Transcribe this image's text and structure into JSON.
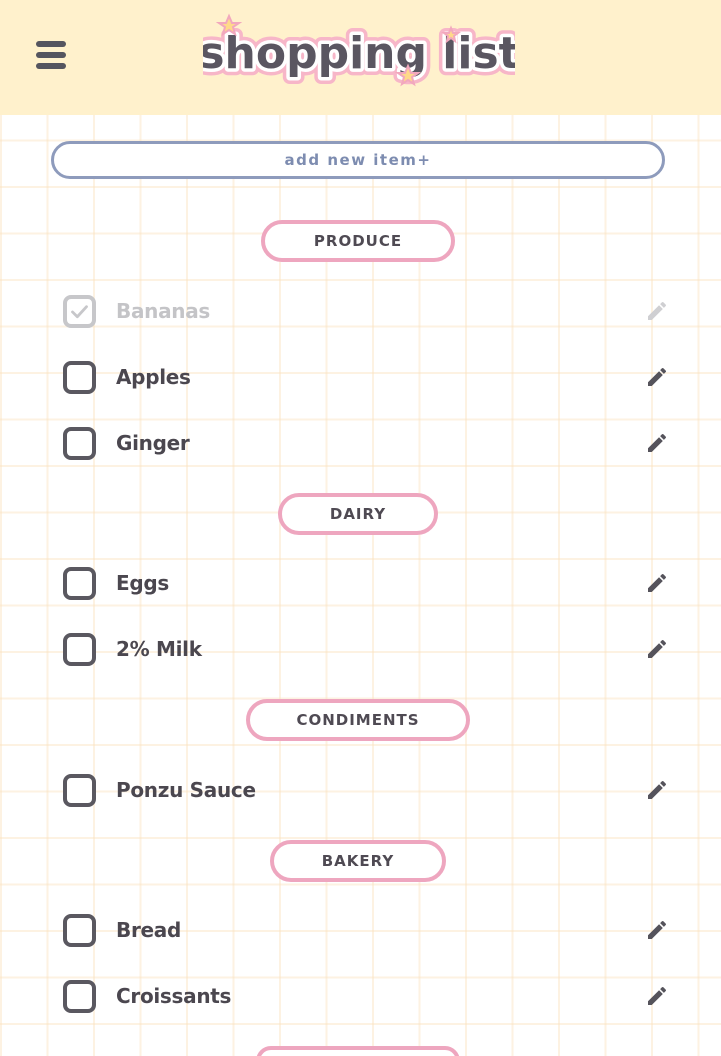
{
  "header": {
    "logo_text": "shopping list",
    "menu_icon": "hamburger-menu-icon"
  },
  "add_button": {
    "label": "add new item+"
  },
  "categories": [
    {
      "name": "PRODUCE",
      "items": [
        {
          "name": "Bananas",
          "checked": true
        },
        {
          "name": "Apples",
          "checked": false
        },
        {
          "name": "Ginger",
          "checked": false
        }
      ]
    },
    {
      "name": "DAIRY",
      "items": [
        {
          "name": "Eggs",
          "checked": false
        },
        {
          "name": "2% Milk",
          "checked": false
        }
      ]
    },
    {
      "name": "CONDIMENTS",
      "items": [
        {
          "name": "Ponzu Sauce",
          "checked": false
        }
      ]
    },
    {
      "name": "BAKERY",
      "items": [
        {
          "name": "Bread",
          "checked": false
        },
        {
          "name": "Croissants",
          "checked": false
        }
      ]
    }
  ],
  "colors": {
    "header_bg": "#fff1cc",
    "category_border": "#eea6bf",
    "add_button_border": "#8e9bbc",
    "text_dark": "#4b474f",
    "text_checked": "#c4c4c7"
  }
}
